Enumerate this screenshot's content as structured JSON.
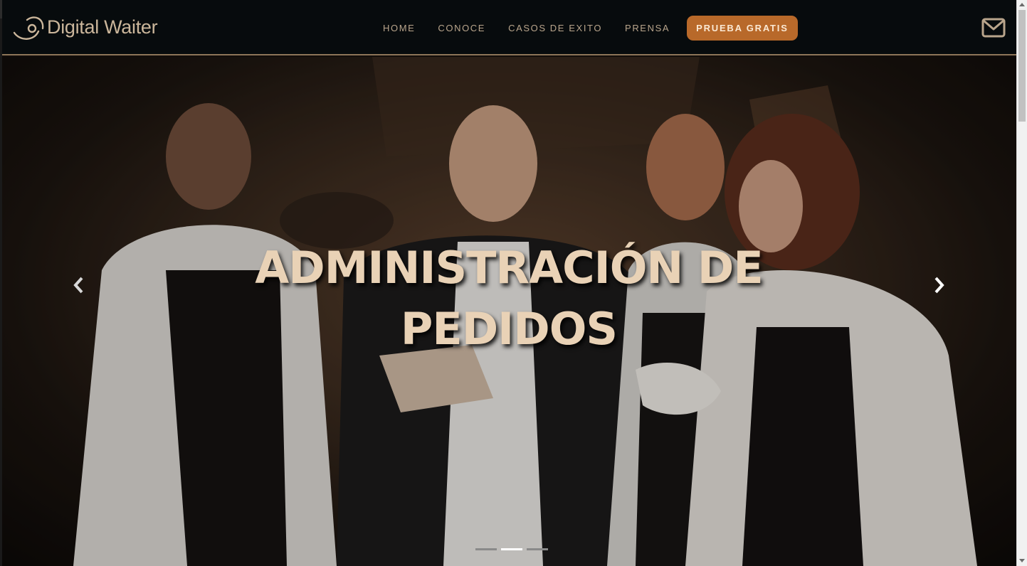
{
  "brand": {
    "name": "Digital Waiter"
  },
  "nav": {
    "items": [
      {
        "label": "HOME"
      },
      {
        "label": "CONOCE"
      },
      {
        "label": "CASOS DE EXITO"
      },
      {
        "label": "PRENSA"
      }
    ],
    "cta_label": "PRUEBA GRATIS"
  },
  "hero": {
    "headline": "ADMINISTRACIÓN DE PEDIDOS",
    "slide_count": 3,
    "active_slide": 2
  },
  "icons": {
    "mail": "envelope-icon",
    "prev": "chevron-left-icon",
    "next": "chevron-right-icon"
  },
  "colors": {
    "accent": "#b8692a",
    "nav_text": "#b9a58c",
    "headline": "#e9d2b6",
    "nav_border": "#8d7559"
  }
}
